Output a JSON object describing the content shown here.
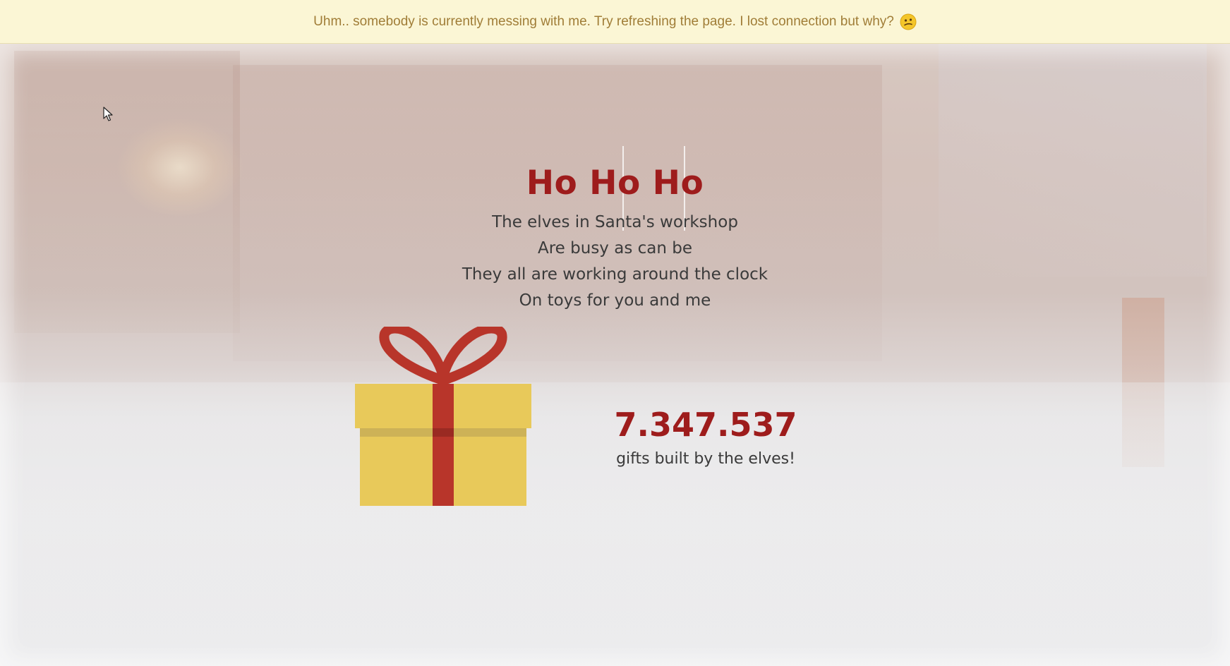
{
  "banner": {
    "message": "Uhm.. somebody is currently messing with me. Try refreshing the page. I lost connection but why?",
    "emoji_icon": "confused-face-icon",
    "background_color": "#fbf6d5",
    "text_color": "#a07d37"
  },
  "poem": {
    "title": "Ho Ho Ho",
    "lines": [
      "The elves in Santa's workshop",
      "Are busy as can be",
      "They all are working around the clock",
      "On toys for you and me"
    ]
  },
  "counter": {
    "value": "7.347.537",
    "label": "gifts built by the elves!"
  },
  "gift": {
    "icon": "gift-box-icon",
    "box_color": "#e8c95a",
    "ribbon_color": "#b8352a"
  },
  "colors": {
    "accent": "#9e1c1c",
    "text": "#3a3a3a"
  }
}
